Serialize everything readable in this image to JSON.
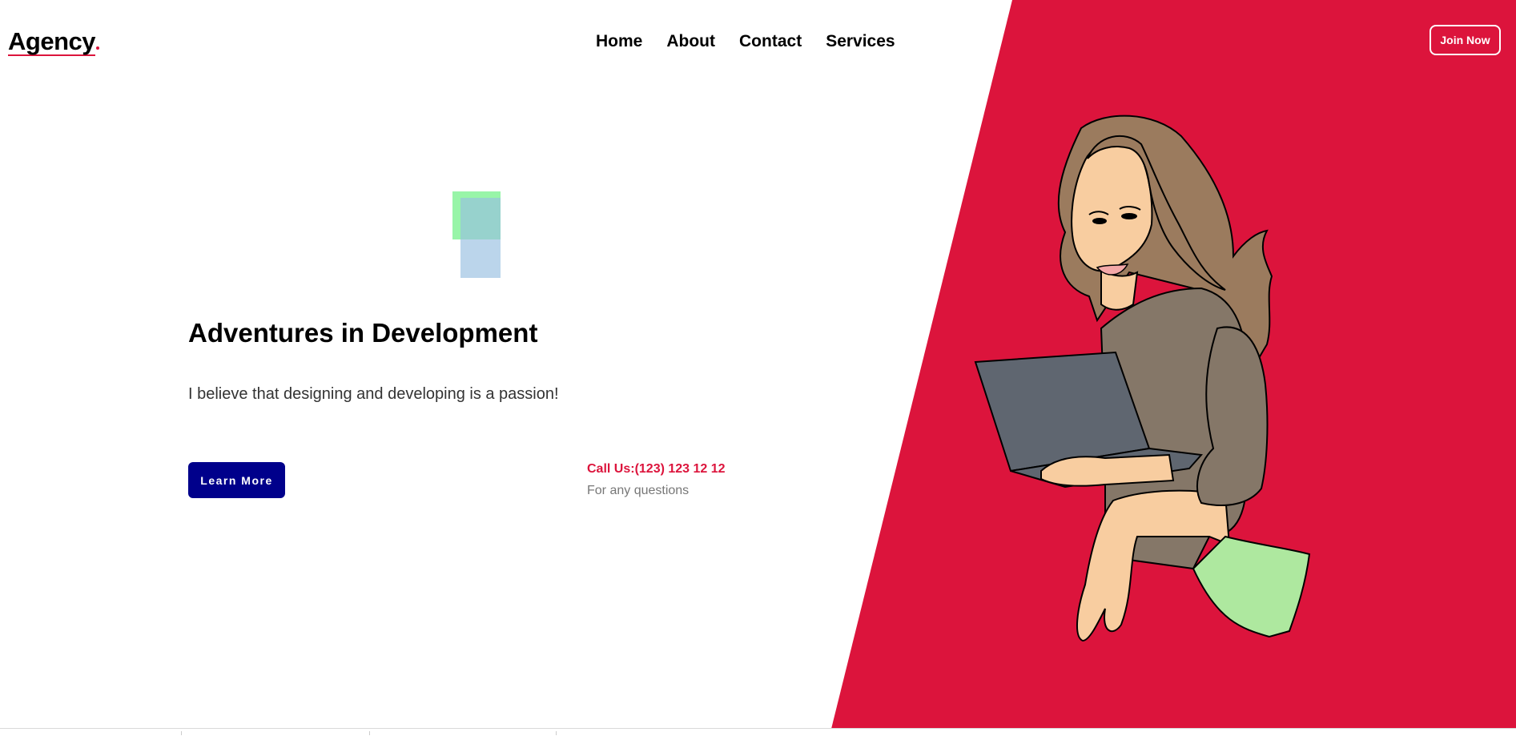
{
  "header": {
    "logo": "Agency",
    "nav": [
      "Home",
      "About",
      "Contact",
      "Services"
    ],
    "join_label": "Join Now"
  },
  "hero": {
    "title": "Adventures in Development",
    "subtitle": "I believe that designing and developing is a passion!",
    "cta_label": "Learn More",
    "call_label": "Call Us:(123) 123 12 12",
    "call_sub": "For any questions"
  },
  "colors": {
    "accent": "#dc143c",
    "button": "#00008b",
    "deco_green": "#98f5a8",
    "deco_blue": "#96bee1"
  },
  "illustration": "woman-with-laptop"
}
